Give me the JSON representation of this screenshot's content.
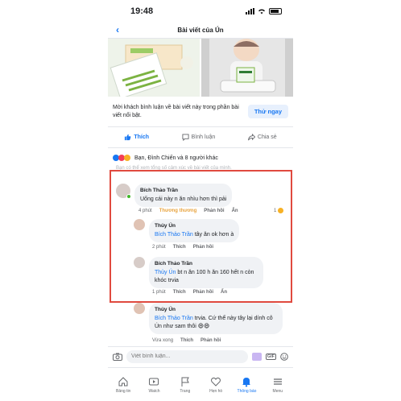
{
  "status_bar": {
    "time": "19:48"
  },
  "navbar": {
    "title": "Bài viết của Ún",
    "back_icon": "chevron-left-icon"
  },
  "invite": {
    "text": "Mời khách bình luận về bài viết này trong phần bài viết nổi bật.",
    "button": "Thử ngay"
  },
  "actions": [
    {
      "label": "Thích",
      "icon": "like-icon"
    },
    {
      "label": "Bình luận",
      "icon": "comment-icon"
    },
    {
      "label": "Chia sẻ",
      "icon": "share-icon"
    }
  ],
  "reactions": {
    "summary": "Bạn, Đình Chiến và 8 người khác"
  },
  "hint": "Bạn có thể xem tổng số cảm xúc về bài viết của mình.",
  "comments": [
    {
      "author": "Bích Thảo Trần",
      "text": "Uống cái này n ăn nhìu hơn thì pải",
      "time": "4 phút",
      "reaction_word": "Thương thương",
      "reply": "Phản hồi",
      "hide": "Ẩn",
      "reaction_count": "1"
    },
    {
      "author": "Thủy Ún",
      "mention": "Bích Thảo Trần",
      "text": "tây ăn ok hơn à",
      "time": "2 phút",
      "like": "Thích",
      "reply": "Phản hồi"
    },
    {
      "author": "Bích Thảo Trần",
      "mention": "Thủy Ún",
      "text": "bt n ăn 100 h ăn 160 hết n còn khóc trvia",
      "time": "1 phút",
      "like": "Thích",
      "reply": "Phản hồi",
      "hide": "Ẩn"
    },
    {
      "author": "Thủy Ún",
      "mention": "Bích Thảo Trần",
      "text": "trvia. Cứ thể này tây lại dính cô Ún như sam thôi 😄😄",
      "time": "Vừa xong",
      "like": "Thích",
      "reply": "Phản hồi"
    }
  ],
  "composer": {
    "placeholder": "Viết bình luận...",
    "camera_icon": "camera-icon",
    "gif_label": "GIF"
  },
  "tabs": [
    {
      "label": "Bảng tin",
      "icon": "home-icon"
    },
    {
      "label": "Watch",
      "icon": "watch-icon"
    },
    {
      "label": "Trang",
      "icon": "flag-icon"
    },
    {
      "label": "Hẹn hò",
      "icon": "heart-icon"
    },
    {
      "label": "Thông báo",
      "icon": "bell-icon"
    },
    {
      "label": "Menu",
      "icon": "menu-icon"
    }
  ],
  "colors": {
    "accent": "#1877f2",
    "highlight": "#e04a3f",
    "reaction_word": "#e8a33d"
  }
}
